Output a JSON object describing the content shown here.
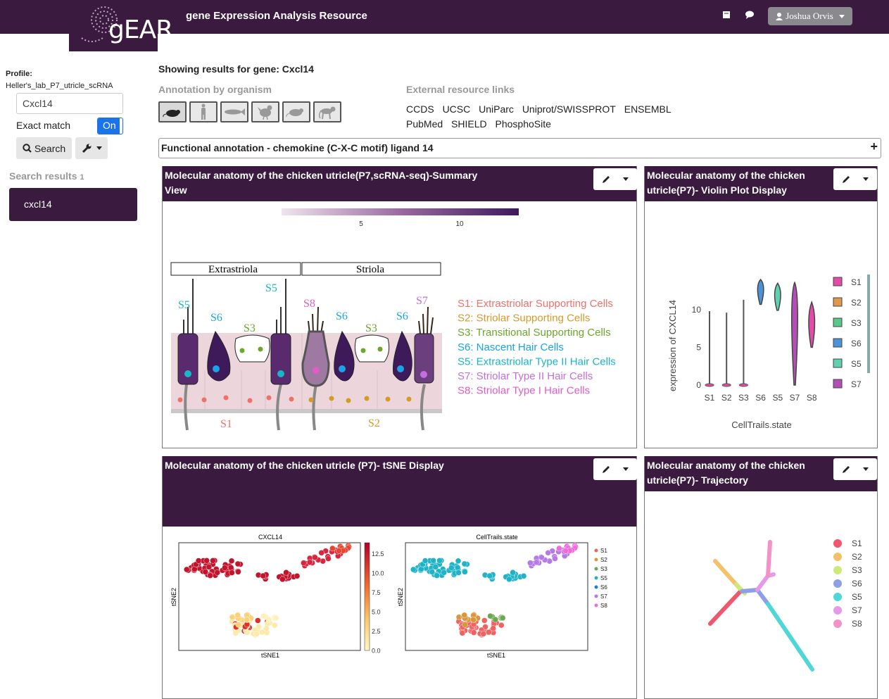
{
  "nav": {
    "logo_text": "gEAR",
    "title": "gene Expression Analysis Resource",
    "user": "Joshua Orvis",
    "icons": [
      "book-icon",
      "comment-icon",
      "user-icon"
    ]
  },
  "sidebar": {
    "profile_label": "Profile:",
    "profile_value": "Heller's_lab_P7_utricle_scRNA",
    "search_value": "Cxcl14",
    "exact_match_label": "Exact match",
    "exact_match_toggle": "On",
    "search_button": "Search",
    "results_label": "Search results",
    "results_count": "1",
    "results": [
      "cxcl14"
    ]
  },
  "main": {
    "showing": "Showing results for gene: Cxcl14",
    "annotation_heading": "Annotation by organism",
    "organisms": [
      "mouse-icon",
      "human-icon",
      "zebrafish-icon",
      "chicken-icon",
      "rat-icon",
      "monkey-icon"
    ],
    "external_heading": "External resource links",
    "external_links": [
      "CCDS",
      "UCSC",
      "UniParc",
      "Uniprot/SWISSPROT",
      "ENSEMBL",
      "PubMed",
      "SHIELD",
      "PhosphoSite"
    ],
    "functional_annotation": "Functional annotation - chemokine (C-X-C motif) ligand 14"
  },
  "panels": {
    "summary": {
      "title": "Molecular anatomy of the chicken utricle(P7,scRNA-seq)-Summary View",
      "colorbar_ticks": [
        "5",
        "10"
      ],
      "region_extrastriola": "Extrastriola",
      "region_striola": "Striola",
      "cell_labels": [
        "S5",
        "S6",
        "S3",
        "S5",
        "S8",
        "S6",
        "S3",
        "S6",
        "S7",
        "S1",
        "S2"
      ],
      "legend": [
        {
          "text": "S1: Extrastriolar Supporting Cells",
          "color": "#f0706a"
        },
        {
          "text": "S2: Striolar Supporting Cells",
          "color": "#d49a2a"
        },
        {
          "text": "S3: Transitional Supporting Cells",
          "color": "#6aa829"
        },
        {
          "text": "S6: Nascent Hair Cells",
          "color": "#1aa3e6"
        },
        {
          "text": "S5: Extrastriolar Type II Hair Cells",
          "color": "#19b5c9"
        },
        {
          "text": "S7: Striolar Type II Hair Cells",
          "color": "#c46ee0"
        },
        {
          "text": "S8: Striolar Type I Hair Cells",
          "color": "#e25bc6"
        }
      ]
    },
    "violin": {
      "title": "Molecular anatomy of the chicken utricle(P7)- Violin Plot Display",
      "ylabel": "expression of CXCL14",
      "xlabel": "CellTrails.state",
      "yticks": [
        "0",
        "5",
        "10"
      ],
      "legend": [
        {
          "name": "S1",
          "color": "#e34ba8"
        },
        {
          "name": "S2",
          "color": "#e0974e"
        },
        {
          "name": "S3",
          "color": "#59c98a"
        },
        {
          "name": "S6",
          "color": "#4a93d6"
        },
        {
          "name": "S5",
          "color": "#5fd1b0"
        },
        {
          "name": "S7",
          "color": "#b34fb4"
        }
      ]
    },
    "tsne": {
      "title": "Molecular anatomy of the chicken utricle (P7)- tSNE Display",
      "left_title": "CXCL14",
      "right_title": "CellTrails.state",
      "xlabel": "tSNE1",
      "ylabel": "tSNE2",
      "colorbar_ticks": [
        "12.5",
        "10.0",
        "7.5",
        "5.0",
        "2.5",
        "0.0"
      ],
      "legend": [
        {
          "name": "S1",
          "color": "#f06262"
        },
        {
          "name": "S2",
          "color": "#d9963a"
        },
        {
          "name": "S3",
          "color": "#6aa84f"
        },
        {
          "name": "S5",
          "color": "#1fb3c7"
        },
        {
          "name": "S6",
          "color": "#1f7fd1"
        },
        {
          "name": "S7",
          "color": "#b57ae8"
        },
        {
          "name": "S8",
          "color": "#f26ad9"
        }
      ]
    },
    "trajectory": {
      "title": "Molecular anatomy of the chicken utricle(P7)- Trajectory",
      "legend": [
        {
          "name": "S1",
          "color": "#f0566c"
        },
        {
          "name": "S2",
          "color": "#f4c06a"
        },
        {
          "name": "S3",
          "color": "#cfe87a"
        },
        {
          "name": "S6",
          "color": "#8d9fe6"
        },
        {
          "name": "S5",
          "color": "#4fd6d6"
        },
        {
          "name": "S7",
          "color": "#e49ae8"
        },
        {
          "name": "S8",
          "color": "#f292c9"
        }
      ]
    }
  },
  "chart_data": [
    {
      "type": "violin",
      "title": "",
      "xlabel": "CellTrails.state",
      "ylabel": "expression of CXCL14",
      "categories": [
        "S1",
        "S2",
        "S3",
        "S6",
        "S5",
        "S7",
        "S8"
      ],
      "ylim": [
        0,
        14
      ],
      "max": [
        9.8,
        9.6,
        11.3,
        14.0,
        13.5,
        13.6,
        11.0
      ],
      "median": [
        0,
        0,
        0,
        13.2,
        12.4,
        11.8,
        9.0
      ]
    }
  ]
}
